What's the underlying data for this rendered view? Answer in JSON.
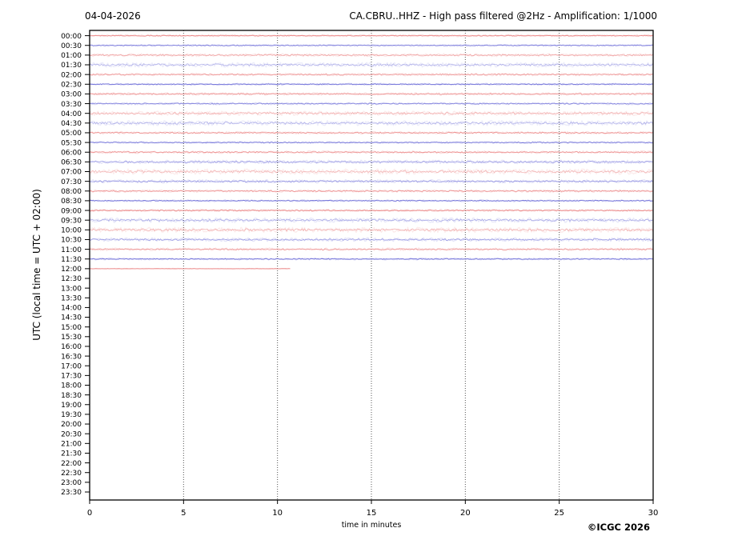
{
  "header": {
    "date": "04-04-2026",
    "title": "CA.CBRU..HHZ - High pass filtered @2Hz - Amplification: 1/1000"
  },
  "axes": {
    "ylabel": "UTC (local time = UTC + 02:00)",
    "xlabel": "time in minutes"
  },
  "footer": {
    "copyright": "©ICGC 2026"
  },
  "chart_data": {
    "type": "line",
    "subtype": "helicorder-seismogram",
    "title": "CA.CBRU..HHZ - High pass filtered @2Hz - Amplification: 1/1000",
    "date": "04-04-2026",
    "xlabel": "time in minutes",
    "ylabel": "UTC (local time = UTC + 02:00)",
    "xlim": [
      0,
      30
    ],
    "x_ticks": [
      0,
      5,
      10,
      15,
      20,
      25,
      30
    ],
    "grid": "vertical-dotted",
    "colors": {
      "red": "#e97878",
      "blue": "#6e6ed8"
    },
    "rows": [
      {
        "label": "00:00",
        "color": "red",
        "amp": 0.5,
        "alpha": 0.85,
        "end": 30
      },
      {
        "label": "00:30",
        "color": "blue",
        "amp": 0.5,
        "alpha": 0.85,
        "end": 30
      },
      {
        "label": "01:00",
        "color": "red",
        "amp": 0.8,
        "alpha": 0.6,
        "end": 30
      },
      {
        "label": "01:30",
        "color": "blue",
        "amp": 1.3,
        "alpha": 0.45,
        "end": 30
      },
      {
        "label": "02:00",
        "color": "red",
        "amp": 0.7,
        "alpha": 0.7,
        "end": 30
      },
      {
        "label": "02:30",
        "color": "blue",
        "amp": 0.5,
        "alpha": 0.95,
        "end": 30
      },
      {
        "label": "03:00",
        "color": "red",
        "amp": 0.7,
        "alpha": 0.75,
        "end": 30
      },
      {
        "label": "03:30",
        "color": "blue",
        "amp": 0.6,
        "alpha": 0.8,
        "end": 30
      },
      {
        "label": "04:00",
        "color": "red",
        "amp": 1.2,
        "alpha": 0.5,
        "end": 30
      },
      {
        "label": "04:30",
        "color": "blue",
        "amp": 1.4,
        "alpha": 0.45,
        "end": 30
      },
      {
        "label": "05:00",
        "color": "red",
        "amp": 0.7,
        "alpha": 0.75,
        "end": 30
      },
      {
        "label": "05:30",
        "color": "blue",
        "amp": 0.5,
        "alpha": 0.9,
        "end": 30
      },
      {
        "label": "06:00",
        "color": "red",
        "amp": 0.7,
        "alpha": 0.75,
        "end": 30
      },
      {
        "label": "06:30",
        "color": "blue",
        "amp": 1.0,
        "alpha": 0.6,
        "end": 30
      },
      {
        "label": "07:00",
        "color": "red",
        "amp": 1.5,
        "alpha": 0.45,
        "end": 30
      },
      {
        "label": "07:30",
        "color": "blue",
        "amp": 0.9,
        "alpha": 0.65,
        "end": 30
      },
      {
        "label": "08:00",
        "color": "red",
        "amp": 0.7,
        "alpha": 0.75,
        "end": 30
      },
      {
        "label": "08:30",
        "color": "blue",
        "amp": 0.5,
        "alpha": 0.95,
        "end": 30
      },
      {
        "label": "09:00",
        "color": "red",
        "amp": 0.6,
        "alpha": 0.85,
        "end": 30
      },
      {
        "label": "09:30",
        "color": "blue",
        "amp": 1.3,
        "alpha": 0.5,
        "end": 30
      },
      {
        "label": "10:00",
        "color": "red",
        "amp": 1.4,
        "alpha": 0.5,
        "end": 30
      },
      {
        "label": "10:30",
        "color": "blue",
        "amp": 1.0,
        "alpha": 0.6,
        "end": 30
      },
      {
        "label": "11:00",
        "color": "red",
        "amp": 0.7,
        "alpha": 0.7,
        "end": 30
      },
      {
        "label": "11:30",
        "color": "blue",
        "amp": 0.5,
        "alpha": 0.95,
        "end": 30
      },
      {
        "label": "12:00",
        "color": "red",
        "amp": 0.15,
        "alpha": 0.8,
        "end": 10.7
      },
      {
        "label": "12:30",
        "color": "blue",
        "amp": 0,
        "alpha": 0,
        "end": 0
      },
      {
        "label": "13:00",
        "color": "red",
        "amp": 0,
        "alpha": 0,
        "end": 0
      },
      {
        "label": "13:30",
        "color": "blue",
        "amp": 0,
        "alpha": 0,
        "end": 0
      },
      {
        "label": "14:00",
        "color": "red",
        "amp": 0,
        "alpha": 0,
        "end": 0
      },
      {
        "label": "14:30",
        "color": "blue",
        "amp": 0,
        "alpha": 0,
        "end": 0
      },
      {
        "label": "15:00",
        "color": "red",
        "amp": 0,
        "alpha": 0,
        "end": 0
      },
      {
        "label": "15:30",
        "color": "blue",
        "amp": 0,
        "alpha": 0,
        "end": 0
      },
      {
        "label": "16:00",
        "color": "red",
        "amp": 0,
        "alpha": 0,
        "end": 0
      },
      {
        "label": "16:30",
        "color": "blue",
        "amp": 0,
        "alpha": 0,
        "end": 0
      },
      {
        "label": "17:00",
        "color": "red",
        "amp": 0,
        "alpha": 0,
        "end": 0
      },
      {
        "label": "17:30",
        "color": "blue",
        "amp": 0,
        "alpha": 0,
        "end": 0
      },
      {
        "label": "18:00",
        "color": "red",
        "amp": 0,
        "alpha": 0,
        "end": 0
      },
      {
        "label": "18:30",
        "color": "blue",
        "amp": 0,
        "alpha": 0,
        "end": 0
      },
      {
        "label": "19:00",
        "color": "red",
        "amp": 0,
        "alpha": 0,
        "end": 0
      },
      {
        "label": "19:30",
        "color": "blue",
        "amp": 0,
        "alpha": 0,
        "end": 0
      },
      {
        "label": "20:00",
        "color": "red",
        "amp": 0,
        "alpha": 0,
        "end": 0
      },
      {
        "label": "20:30",
        "color": "blue",
        "amp": 0,
        "alpha": 0,
        "end": 0
      },
      {
        "label": "21:00",
        "color": "red",
        "amp": 0,
        "alpha": 0,
        "end": 0
      },
      {
        "label": "21:30",
        "color": "blue",
        "amp": 0,
        "alpha": 0,
        "end": 0
      },
      {
        "label": "22:00",
        "color": "red",
        "amp": 0,
        "alpha": 0,
        "end": 0
      },
      {
        "label": "22:30",
        "color": "blue",
        "amp": 0,
        "alpha": 0,
        "end": 0
      },
      {
        "label": "23:00",
        "color": "red",
        "amp": 0,
        "alpha": 0,
        "end": 0
      },
      {
        "label": "23:30",
        "color": "blue",
        "amp": 0,
        "alpha": 0,
        "end": 0
      }
    ]
  }
}
